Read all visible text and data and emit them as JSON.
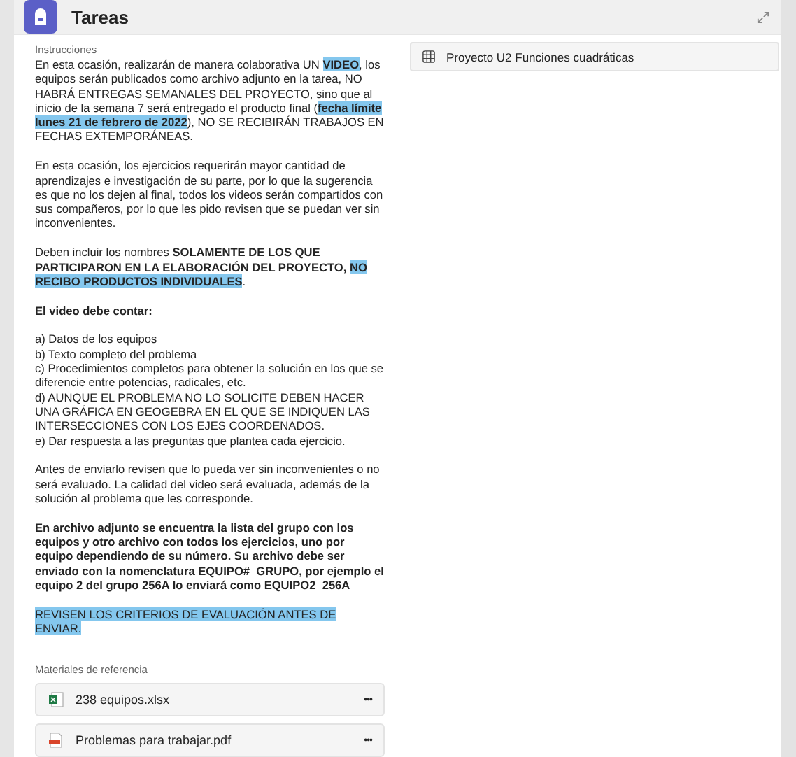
{
  "header": {
    "title": "Tareas"
  },
  "instructions": {
    "label": "Instrucciones",
    "paragraphs": [
      {
        "segments": [
          {
            "text": "En esta ocasión, realizarán de manera colaborativa UN ",
            "bold": false,
            "highlighted": false
          },
          {
            "text": "VIDEO",
            "bold": true,
            "highlighted": true
          },
          {
            "text": ", los equipos serán publicados como archivo adjunto en la tarea, NO HABRÁ ENTREGAS SEMANALES DEL PROYECTO, sino que al inicio de la semana 7 será entregado el producto final (",
            "bold": false,
            "highlighted": false
          },
          {
            "text": "fecha límite lunes 21 de febrero de 2022",
            "bold": true,
            "highlighted": true
          },
          {
            "text": "), NO SE RECIBIRÁN TRABAJOS EN FECHAS EXTEMPORÁNEAS.",
            "bold": false,
            "highlighted": false
          }
        ]
      },
      {
        "segments": [
          {
            "text": "En esta ocasión, los ejercicios requerirán mayor cantidad de aprendizajes e investigación de su parte, por lo que la sugerencia es que no los dejen al final, todos los videos serán compartidos con sus compañeros, por lo que les pido revisen que se puedan ver sin inconvenientes.",
            "bold": false,
            "highlighted": false
          }
        ]
      },
      {
        "segments": [
          {
            "text": "Deben incluir los nombres ",
            "bold": false,
            "highlighted": false
          },
          {
            "text": "SOLAMENTE DE LOS QUE PARTICIPARON EN LA ELABORACIÓN DEL PROYECTO, ",
            "bold": true,
            "highlighted": false
          },
          {
            "text": "NO RECIBO PRODUCTOS INDIVIDUALES",
            "bold": true,
            "highlighted": true
          },
          {
            "text": ".",
            "bold": false,
            "highlighted": false
          }
        ]
      },
      {
        "segments": [
          {
            "text": "El video debe contar:",
            "bold": true,
            "highlighted": false
          }
        ]
      },
      {
        "lines": [
          "a) Datos de los equipos",
          "b) Texto completo del problema",
          "c) Procedimientos completos para obtener la solución en los que se diferencie entre potencias, radicales, etc.",
          "d) AUNQUE EL PROBLEMA NO LO SOLICITE DEBEN HACER UNA GRÁFICA EN GEOGEBRA EN EL QUE SE INDIQUEN LAS INTERSECCIONES CON LOS EJES COORDENADOS.",
          "e) Dar respuesta a las preguntas que plantea cada ejercicio."
        ]
      },
      {
        "segments": [
          {
            "text": "Antes de enviarlo revisen que lo pueda ver sin inconvenientes o no será evaluado. La calidad del video será evaluada, además de la solución al problema que les corresponde.",
            "bold": false,
            "highlighted": false
          }
        ]
      },
      {
        "segments": [
          {
            "text": "En archivo adjunto se encuentra la lista del grupo con los equipos y otro archivo con todos los ejercicios, uno por equipo dependiendo de su número. Su archivo debe ser enviado con la nomenclatura EQUIPO#_GRUPO, por ejemplo el equipo 2 del grupo 256A lo enviará como EQUIPO2_256A",
            "bold": true,
            "highlighted": false
          }
        ]
      },
      {
        "segments": [
          {
            "text": "REVISEN LOS CRITERIOS DE EVALUACIÓN ANTES DE ENVIAR.",
            "bold": false,
            "highlighted": true
          }
        ]
      }
    ]
  },
  "materials": {
    "label": "Materiales de referencia",
    "files": [
      {
        "name": "238 equipos.xlsx",
        "kind": "xlsx",
        "menu": "•••"
      },
      {
        "name": "Problemas para trabajar.pdf",
        "kind": "pdf",
        "menu": "•••"
      }
    ]
  },
  "rubric": {
    "name": "Proyecto U2 Funciones cuadráticas"
  }
}
